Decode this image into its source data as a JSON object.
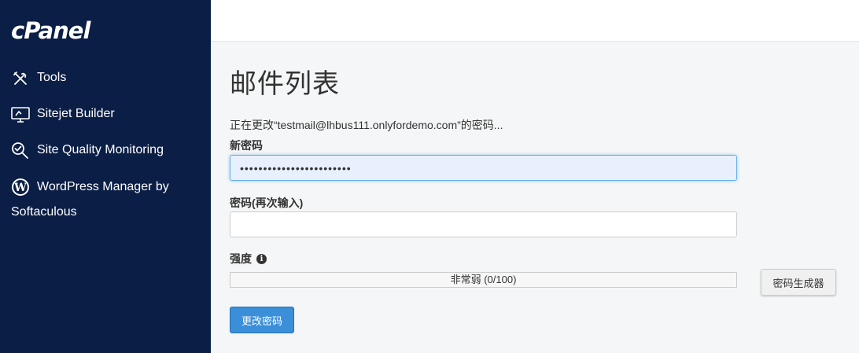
{
  "brand": {
    "logo_text": "cPanel"
  },
  "sidebar": {
    "items": [
      {
        "label": "Tools",
        "icon": "tools-icon"
      },
      {
        "label": "Sitejet Builder",
        "icon": "monitor-icon"
      },
      {
        "label": "Site Quality Monitoring",
        "icon": "magnifier-check-icon"
      },
      {
        "label_line1": "WordPress Manager by",
        "label_line2": "Softaculous",
        "icon": "wordpress-icon"
      }
    ]
  },
  "main": {
    "title": "邮件列表",
    "changing_text": "正在更改“testmail@lhbus111.onlyfordemo.com”的密码...",
    "new_password": {
      "label": "新密码",
      "value": "••••••••••••••••••••••••"
    },
    "confirm_password": {
      "label": "密码(再次输入)",
      "value": ""
    },
    "strength": {
      "label": "强度",
      "text": "非常弱 (0/100)",
      "value": 0
    },
    "generator_button": "密码生成器",
    "submit_button": "更改密码"
  },
  "colors": {
    "sidebar_bg": "#0b1e45",
    "primary_button": "#3b8fd9"
  }
}
